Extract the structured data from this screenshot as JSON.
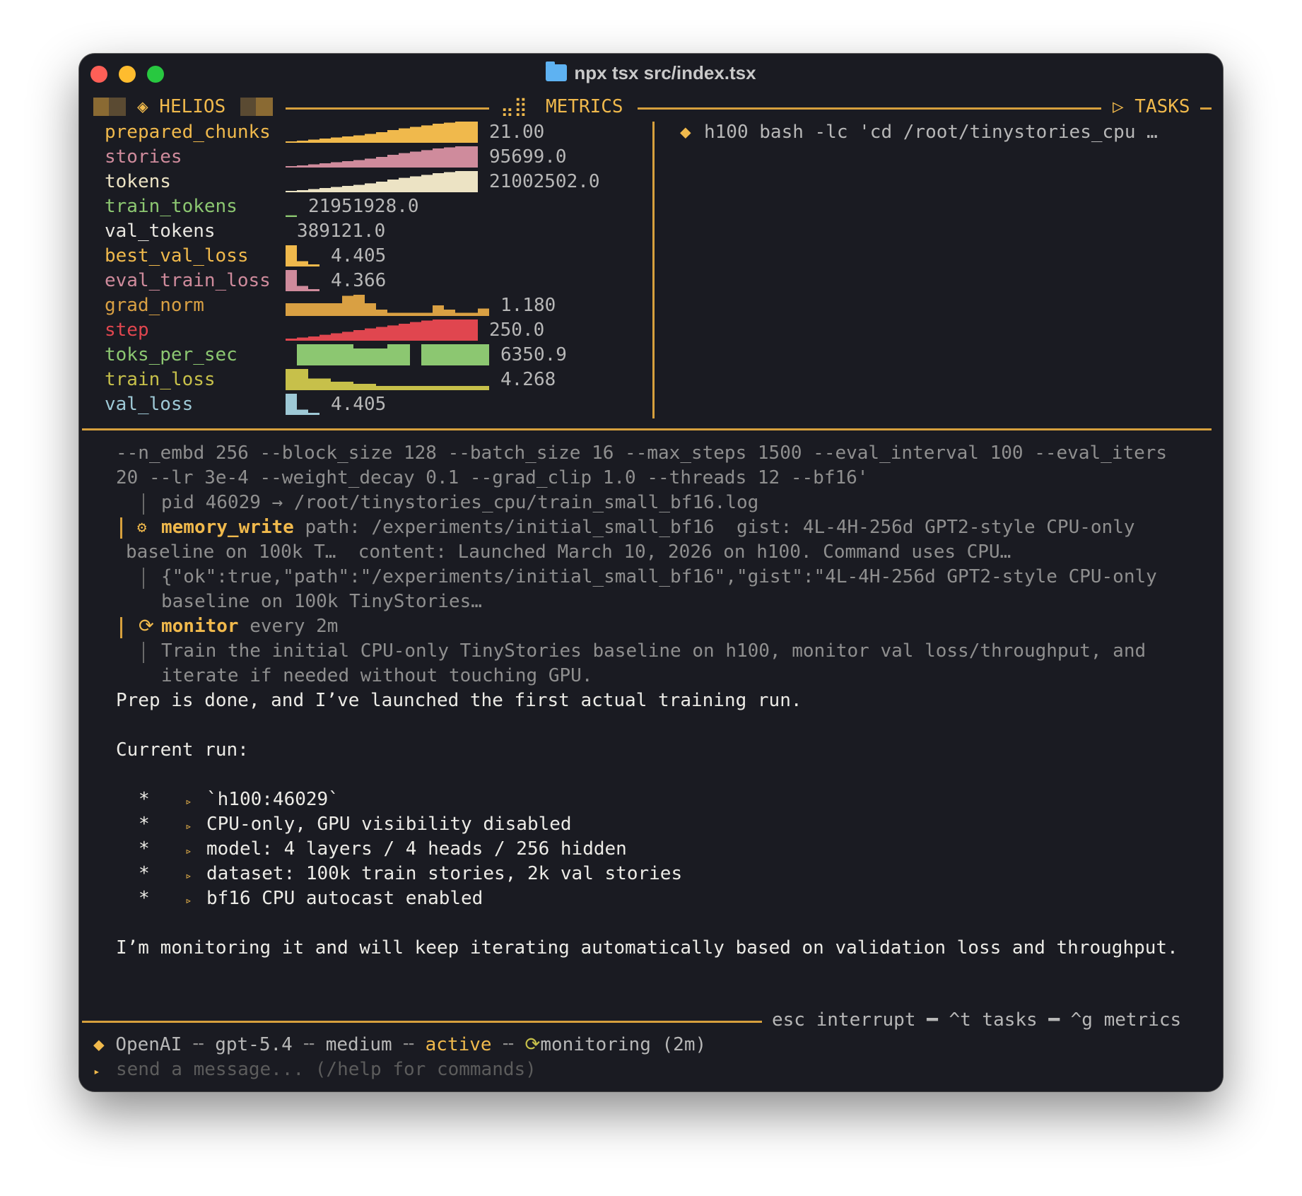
{
  "window": {
    "title": "npx tsx src/index.tsx"
  },
  "header": {
    "left_title": "◈ HELIOS",
    "metrics_title": "METRICS",
    "tasks_title": "▷ TASKS"
  },
  "metrics": [
    {
      "name": "prepared_chunks",
      "value": "21.00",
      "color": "#f0b94c",
      "levels": [
        0.05,
        0.1,
        0.15,
        0.2,
        0.25,
        0.3,
        0.35,
        0.42,
        0.5,
        0.6,
        0.68,
        0.75,
        0.82,
        0.9,
        0.95,
        1.0,
        1.0
      ]
    },
    {
      "name": "stories",
      "value": "95699.0",
      "color": "#cf8b9c",
      "levels": [
        0.05,
        0.1,
        0.15,
        0.2,
        0.25,
        0.3,
        0.35,
        0.42,
        0.5,
        0.6,
        0.68,
        0.75,
        0.82,
        0.9,
        0.95,
        1.0,
        1.0
      ]
    },
    {
      "name": "tokens",
      "value": "21002502.0",
      "color": "#ece3c4",
      "levels": [
        0.05,
        0.1,
        0.15,
        0.2,
        0.25,
        0.3,
        0.35,
        0.42,
        0.5,
        0.6,
        0.68,
        0.75,
        0.82,
        0.9,
        0.95,
        1.0,
        1.0
      ]
    },
    {
      "name": "train_tokens",
      "value": "21951928.0",
      "color": "#8cc771",
      "levels": [
        0.08
      ]
    },
    {
      "name": "val_tokens",
      "value": "389121.0",
      "color": "#e8e6e0",
      "levels": []
    },
    {
      "name": "best_val_loss",
      "value": "4.405",
      "color": "#f0b94c",
      "levels": [
        1.0,
        0.25,
        0.1
      ]
    },
    {
      "name": "eval_train_loss",
      "value": "4.366",
      "color": "#cf8b9c",
      "levels": [
        1.0,
        0.25,
        0.1
      ]
    },
    {
      "name": "grad_norm",
      "value": "1.180",
      "color": "#d9a043",
      "levels": [
        0.6,
        0.6,
        0.6,
        0.6,
        0.6,
        0.95,
        1.0,
        0.6,
        0.3,
        0.15,
        0.15,
        0.15,
        0.15,
        0.5,
        0.3,
        0.15,
        0.15,
        0.35
      ]
    },
    {
      "name": "step",
      "value": "250.0",
      "color": "#e0464f",
      "levels": [
        0.1,
        0.15,
        0.2,
        0.28,
        0.35,
        0.42,
        0.5,
        0.58,
        0.65,
        0.72,
        0.8,
        0.88,
        0.95,
        1.0,
        1.0,
        1.0,
        1.0
      ]
    },
    {
      "name": "toks_per_sec",
      "value": "6350.9",
      "color": "#8cc771",
      "levels": [
        0,
        1,
        1,
        1,
        1,
        1,
        0.8,
        0.8,
        0.8,
        1,
        1,
        0,
        1,
        1,
        1,
        1,
        1,
        1
      ]
    },
    {
      "name": "train_loss",
      "value": "4.268",
      "color": "#c7c04a",
      "levels": [
        1.0,
        1.0,
        0.55,
        0.55,
        0.4,
        0.4,
        0.3,
        0.3,
        0.2,
        0.2,
        0.2,
        0.2,
        0.2,
        0.2,
        0.2,
        0.2,
        0.2,
        0.2
      ]
    },
    {
      "name": "val_loss",
      "value": "4.405",
      "color": "#9ec9d6",
      "levels": [
        1.0,
        0.25,
        0.1
      ]
    }
  ],
  "tasks": [
    {
      "marker": "◆",
      "text": "h100 bash -lc 'cd /root/tinystories_cpu …"
    }
  ],
  "log": {
    "cmd_line1": "--n_embd 256 --block_size 128 --batch_size 16 --max_steps 1500 --eval_interval 100 --eval_iters",
    "cmd_line2": "20 --lr 3e-4 --weight_decay 0.1 --grad_clip 1.0 --threads 12 --bf16'",
    "pid_line": "pid 46029 → /root/tinystories_cpu/train_small_bf16.log",
    "memory_tool": "memory_write",
    "memory_args_1": " path: /experiments/initial_small_bf16  gist: 4L-4H-256d GPT2-style CPU-only",
    "memory_args_2": "baseline on 100k T…  content: Launched March 10, 2026 on h100. Command uses CPU…",
    "memory_result_1": "{\"ok\":true,\"path\":\"/experiments/initial_small_bf16\",\"gist\":\"4L-4H-256d GPT2-style CPU-only",
    "memory_result_2": "baseline on 100k TinyStories…",
    "monitor_tool": "monitor",
    "monitor_args": " every 2m",
    "monitor_desc_1": "Train the initial CPU-only TinyStories baseline on h100, monitor val loss/throughput, and",
    "monitor_desc_2": "iterate if needed without touching GPU.",
    "summary": "Prep is done, and I’ve launched the first actual training run.",
    "current_run": "Current run:",
    "bullets": [
      "`h100:46029`",
      "CPU-only, GPU visibility disabled",
      "model: 4 layers / 4 heads / 256 hidden",
      "dataset: 100k train stories, 2k val stories",
      "bf16 CPU autocast enabled"
    ],
    "closing": "I’m monitoring it and will keep iterating automatically based on validation loss and throughput."
  },
  "footer": {
    "shortcuts": "esc interrupt ━ ^t tasks ━ ^g metrics",
    "provider": "OpenAI",
    "model": "gpt-5.4",
    "effort": "medium",
    "state": "active",
    "monitoring": "monitoring (2m)",
    "input_placeholder": "send a message... (/help for commands)"
  }
}
